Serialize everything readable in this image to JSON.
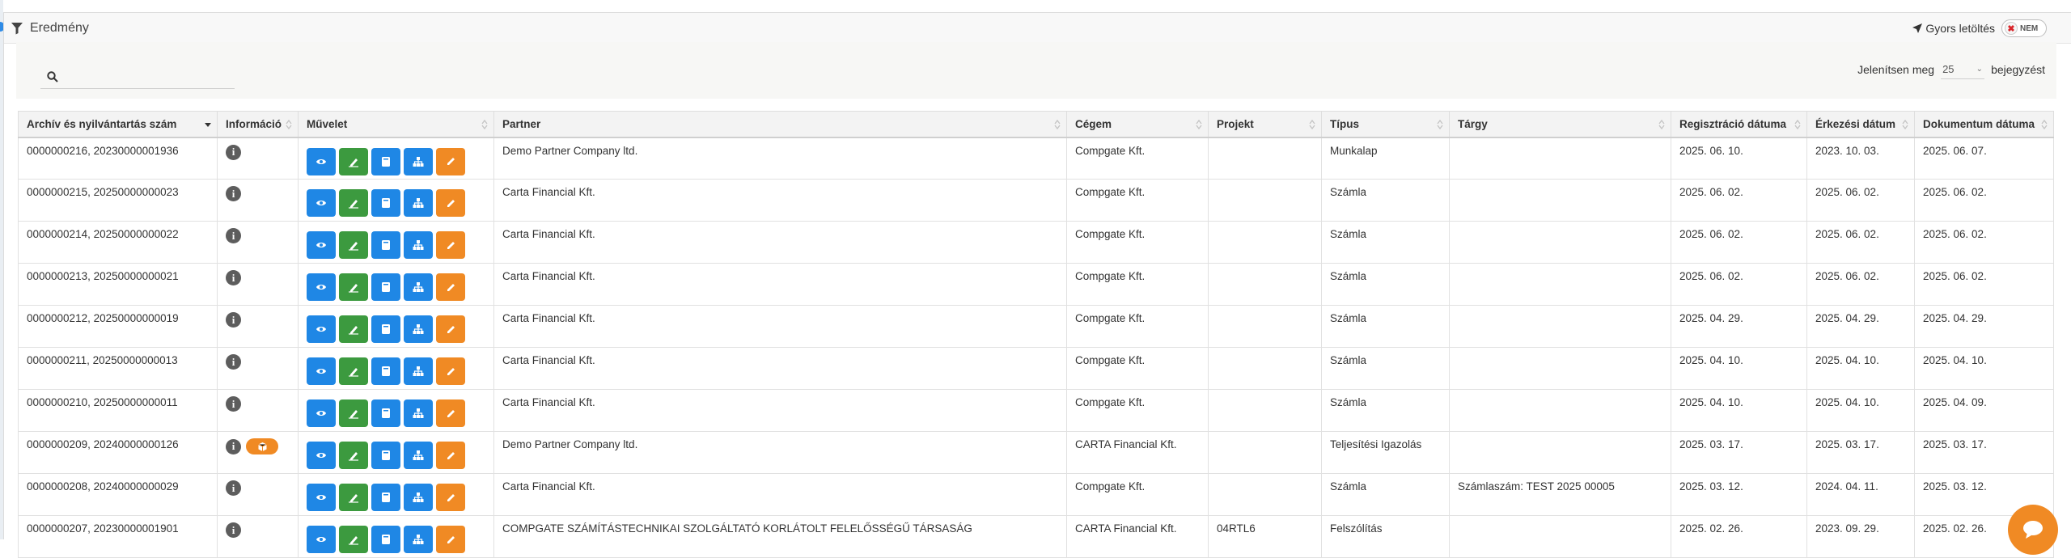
{
  "panel": {
    "title": "Eredmény",
    "quick_download_label": "Gyors letöltés",
    "toggle_label": "NEM"
  },
  "toolbar": {
    "search_placeholder": "",
    "show_prefix": "Jelenítsen meg",
    "page_size": "25",
    "show_suffix": "bejegyzést"
  },
  "columns": [
    "Archív és nyilvántartás szám",
    "Információ",
    "Művelet",
    "Partner",
    "Cégem",
    "Projekt",
    "Típus",
    "Tárgy",
    "Regisztráció dátuma",
    "Érkezési dátum",
    "Dokumentum dátuma"
  ],
  "rows": [
    {
      "id": "0000000216, 20230000001936",
      "badge": false,
      "partner": "Demo Partner Company ltd.",
      "company": "Compgate Kft.",
      "project": "",
      "type": "Munkalap",
      "subject": "",
      "reg": "2025. 06. 10.",
      "arr": "2023. 10. 03.",
      "doc": "2025. 06. 07."
    },
    {
      "id": "0000000215, 20250000000023",
      "badge": false,
      "partner": "Carta Financial Kft.",
      "company": "Compgate Kft.",
      "project": "",
      "type": "Számla",
      "subject": "",
      "reg": "2025. 06. 02.",
      "arr": "2025. 06. 02.",
      "doc": "2025. 06. 02."
    },
    {
      "id": "0000000214, 20250000000022",
      "badge": false,
      "partner": "Carta Financial Kft.",
      "company": "Compgate Kft.",
      "project": "",
      "type": "Számla",
      "subject": "",
      "reg": "2025. 06. 02.",
      "arr": "2025. 06. 02.",
      "doc": "2025. 06. 02."
    },
    {
      "id": "0000000213, 20250000000021",
      "badge": false,
      "partner": "Carta Financial Kft.",
      "company": "Compgate Kft.",
      "project": "",
      "type": "Számla",
      "subject": "",
      "reg": "2025. 06. 02.",
      "arr": "2025. 06. 02.",
      "doc": "2025. 06. 02."
    },
    {
      "id": "0000000212, 20250000000019",
      "badge": false,
      "partner": "Carta Financial Kft.",
      "company": "Compgate Kft.",
      "project": "",
      "type": "Számla",
      "subject": "",
      "reg": "2025. 04. 29.",
      "arr": "2025. 04. 29.",
      "doc": "2025. 04. 29."
    },
    {
      "id": "0000000211, 20250000000013",
      "badge": false,
      "partner": "Carta Financial Kft.",
      "company": "Compgate Kft.",
      "project": "",
      "type": "Számla",
      "subject": "",
      "reg": "2025. 04. 10.",
      "arr": "2025. 04. 10.",
      "doc": "2025. 04. 10."
    },
    {
      "id": "0000000210, 20250000000011",
      "badge": false,
      "partner": "Carta Financial Kft.",
      "company": "Compgate Kft.",
      "project": "",
      "type": "Számla",
      "subject": "",
      "reg": "2025. 04. 10.",
      "arr": "2025. 04. 10.",
      "doc": "2025. 04. 09."
    },
    {
      "id": "0000000209, 20240000000126",
      "badge": true,
      "partner": "Demo Partner Company ltd.",
      "company": "CARTA Financial Kft.",
      "project": "",
      "type": "Teljesítési Igazolás",
      "subject": "",
      "reg": "2025. 03. 17.",
      "arr": "2025. 03. 17.",
      "doc": "2025. 03. 17."
    },
    {
      "id": "0000000208, 20240000000029",
      "badge": false,
      "partner": "Carta Financial Kft.",
      "company": "Compgate Kft.",
      "project": "",
      "type": "Számla",
      "subject": "Számlaszám: TEST 2025 00005",
      "reg": "2025. 03. 12.",
      "arr": "2024. 04. 11.",
      "doc": "2025. 03. 12."
    },
    {
      "id": "0000000207, 20230000001901",
      "badge": false,
      "partner": "COMPGATE SZÁMÍTÁSTECHNIKAI SZOLGÁLTATÓ KORLÁTOLT FELELŐSSÉGŰ TÁRSASÁG",
      "company": "CARTA Financial Kft.",
      "project": "04RTL6",
      "type": "Felszólítás",
      "subject": "",
      "reg": "2025. 02. 26.",
      "arr": "2023. 09. 29.",
      "doc": "2025. 02. 26."
    }
  ],
  "colors": {
    "blue": "#1f87e5",
    "green": "#3c9a3f",
    "orange": "#f08a24"
  }
}
